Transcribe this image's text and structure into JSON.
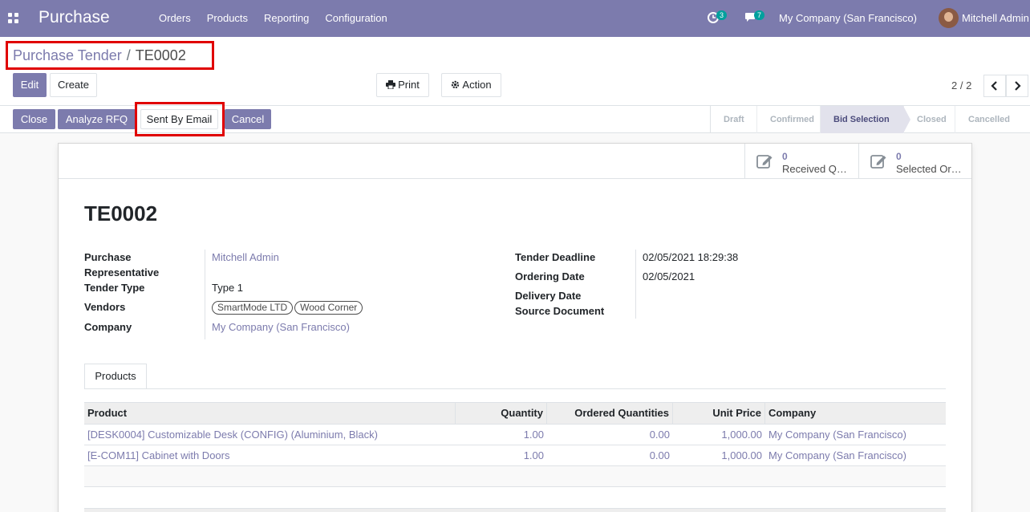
{
  "navbar": {
    "app_name": "Purchase",
    "menu": [
      "Orders",
      "Products",
      "Reporting",
      "Configuration"
    ],
    "activity_count": "3",
    "messages_count": "7",
    "company": "My Company (San Francisco)",
    "user": "Mitchell Admin",
    "brand_color": "#7c7bad"
  },
  "breadcrumb": {
    "parent": "Purchase Tender",
    "separator": "/",
    "current": "TE0002"
  },
  "toolbar": {
    "edit": "Edit",
    "create": "Create",
    "print": "Print",
    "action": "Action",
    "pager": "2 / 2",
    "prev": "‹",
    "next": "›"
  },
  "status_actions": {
    "close": "Close",
    "analyze_rfq": "Analyze RFQ",
    "sent_by_email": "Sent By Email",
    "cancel": "Cancel"
  },
  "stages": [
    {
      "label": "Draft",
      "active": false
    },
    {
      "label": "Confirmed",
      "active": false
    },
    {
      "label": "Bid Selection",
      "active": true
    },
    {
      "label": "Closed",
      "active": false
    },
    {
      "label": "Cancelled",
      "active": false
    }
  ],
  "smart_buttons": [
    {
      "value": "0",
      "label": "Received Q…",
      "icon": "edit-icon"
    },
    {
      "value": "0",
      "label": "Selected Or…",
      "icon": "edit-icon"
    }
  ],
  "record": {
    "title": "TE0002",
    "left_fields": {
      "purchase_rep_label": "Purchase Representative",
      "purchase_rep_value": "Mitchell Admin",
      "tender_type_label": "Tender Type",
      "tender_type_value": "Type 1",
      "vendors_label": "Vendors",
      "vendors": [
        "SmartMode LTD",
        "Wood Corner"
      ],
      "company_label": "Company",
      "company_value": "My Company (San Francisco)"
    },
    "right_fields": {
      "deadline_label": "Tender Deadline",
      "deadline_value": "02/05/2021 18:29:38",
      "ordering_date_label": "Ordering Date",
      "ordering_date_value": "02/05/2021",
      "delivery_date_label": "Delivery Date",
      "source_document_label": "Source Document"
    }
  },
  "tabs": [
    {
      "label": "Products",
      "active": true
    }
  ],
  "products_table": {
    "columns": [
      "Product",
      "Quantity",
      "Ordered Quantities",
      "Unit Price",
      "Company"
    ],
    "rows": [
      [
        "[DESK0004] Customizable Desk (CONFIG) (Aluminium, Black)",
        "1.00",
        "0.00",
        "1,000.00",
        "My Company (San Francisco)"
      ],
      [
        "[E-COM11] Cabinet with Doors",
        "1.00",
        "0.00",
        "1,000.00",
        "My Company (San Francisco)"
      ]
    ]
  }
}
